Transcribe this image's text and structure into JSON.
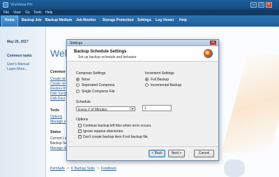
{
  "app": {
    "title": "ViceVersa Pro"
  },
  "menu": [
    "File",
    "View",
    "Go",
    "Tools",
    "Help"
  ],
  "nav_tabs": [
    "Home",
    "Backup Job",
    "Backup Medium",
    "Job Monitor",
    "Storage Protection",
    "Settings",
    "Log Viewer",
    "Help"
  ],
  "sidebar": {
    "date": "May 25, 2017",
    "common_tasks": "Common tasks",
    "links": [
      "User's Manual",
      "Learn More..."
    ]
  },
  "content": {
    "welcome": "Welc",
    "common_head": "Common t",
    "common_links": [
      "Create ne",
      "Create ne",
      "Restore fr",
      "Disk Synch",
      "Disk Encr"
    ],
    "tools_head": "Tools",
    "tools_links": [
      "Options",
      "Manage u"
    ],
    "status_head": "Status",
    "status_lines": [
      "Current Lic",
      "Backup Ser",
      "Manage lic"
    ],
    "footer": [
      "KernSafe",
      "K Backup Suite",
      "Feedback"
    ]
  },
  "dialog": {
    "window_title": "Settings",
    "heading": "Backup Schedule Settings",
    "subheading": "Set up backup schedule and behavior",
    "compress": {
      "label": "Compress Settings",
      "options": [
        "None",
        "Seperated Compress",
        "Single Compress File"
      ],
      "selected": 0
    },
    "increment": {
      "label": "Increment Settings",
      "options": [
        "Full Backup",
        "Incremental Backup"
      ],
      "selected": 0
    },
    "schedule": {
      "label": "Schedule",
      "select_value": "Every # of Minutes",
      "number_value": "1"
    },
    "options": {
      "label": "Options",
      "items": [
        {
          "text": "Continue backup left files when error occurs.",
          "checked": false
        },
        {
          "text": "Ignore reparse directories.",
          "checked": true
        },
        {
          "text": "Don't create backup item if not backup file.",
          "checked": true
        }
      ]
    },
    "buttons": {
      "back": "< Back",
      "next": "Next >",
      "cancel": "Cancel"
    }
  }
}
